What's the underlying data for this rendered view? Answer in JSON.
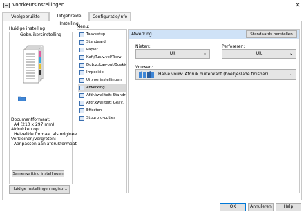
{
  "window": {
    "title": "Voorkeursinstellingen"
  },
  "tabs": [
    {
      "label": "Veelgebruikte instellingen"
    },
    {
      "label": "Uitgebreide Instelling"
    },
    {
      "label": "Configuratie/Info"
    }
  ],
  "left": {
    "heading": "Huidige instelling",
    "preset": "Gebruikersinstelling",
    "summary": [
      "Documentformaat:",
      "A4 (210 x 297 mm)",
      "Afdrukken op:",
      "Hetzelfde formaat als origineel",
      "Verkleinen/Vergroten:",
      "Aanpassen aan afdrukformaat"
    ],
    "summary_button": "Samenvatting instellingen",
    "register_button": "Huidige instellingen registr..."
  },
  "menu": {
    "label": "Menu:",
    "items": [
      "Taaksetup",
      "Standaard",
      "Papier",
      "Kaft/Tus.v.vel/Toew",
      "Dub.z./Lay-out/Boekje",
      "Impositie",
      "Uitvoerinstellingen",
      "Afwerking",
      "Afdr.kwaliteit: Standrd",
      "Afdr.kwaliteit: Geav.",
      "Effecten",
      "Stuurprg-opties"
    ],
    "selected_index": 7
  },
  "panel": {
    "title": "Afwerking",
    "reset_button": "Standaards herstellen",
    "stapling": {
      "label": "Nieten:",
      "value": "Uit"
    },
    "punching": {
      "label": "Perforeren:",
      "value": "Uit"
    },
    "folding": {
      "label": "Vouwen:",
      "value": "Halve vouw: Afdruk buitenkant (boekjeslade finisher)"
    }
  },
  "footer": {
    "ok": "OK",
    "cancel": "Annuleren",
    "help": "Help"
  },
  "colors": {
    "selection": "#d9d9d9",
    "panel_header": "#cfe2f7",
    "icon_blue": "#3a6fb0"
  }
}
